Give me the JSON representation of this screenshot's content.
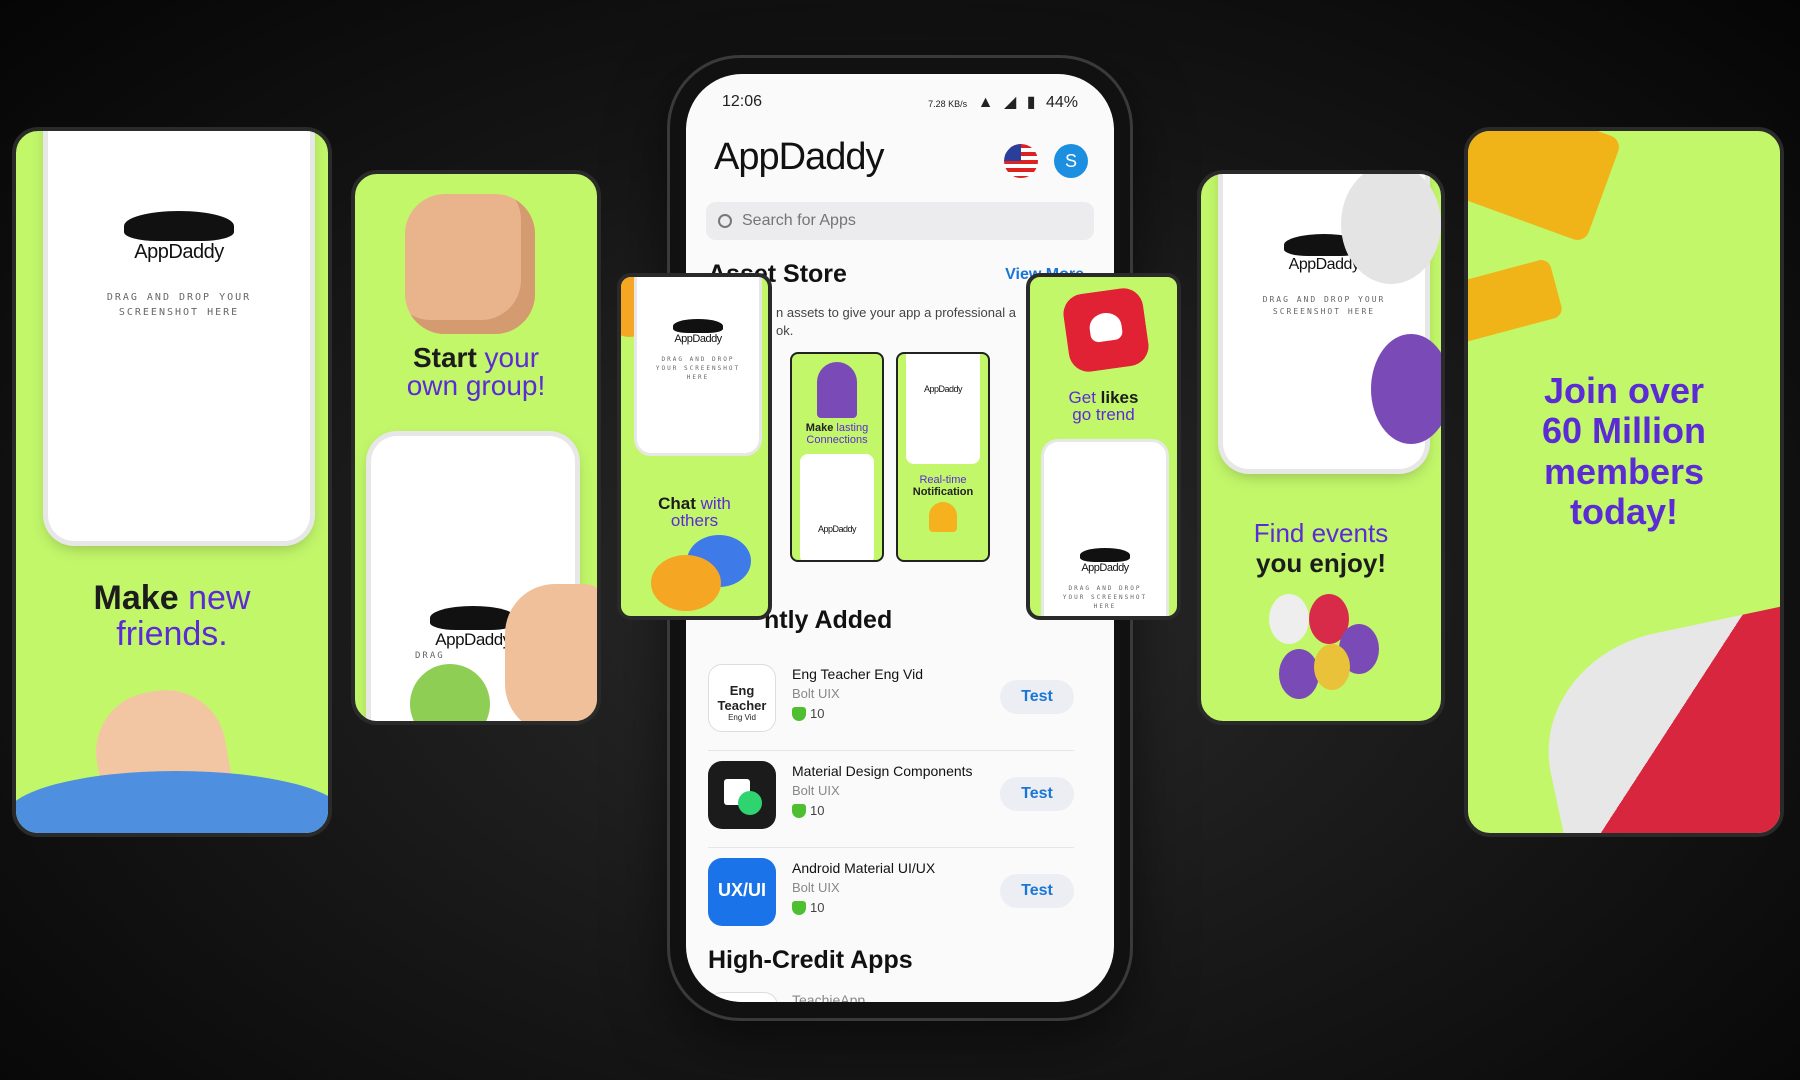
{
  "cards": {
    "c1": {
      "brand": "AppDaddy",
      "drop": "DRAG AND DROP YOUR SCREENSHOT HERE",
      "h_bold": "Make",
      "h_rest": "new",
      "h_line2": "friends."
    },
    "c2": {
      "h_bold": "Start",
      "h_rest": "your",
      "h_line2": "own group!",
      "brand": "AppDaddy",
      "drop": "DRAG"
    },
    "c3": {
      "brand": "AppDaddy",
      "drop": "DRAG AND DROP YOUR SCREENSHOT HERE",
      "h_bold": "Chat",
      "h_rest": "with",
      "h_line2": "others"
    },
    "c4": {
      "h_pre": "Get",
      "h_bold": "likes",
      "h_line2": "go trend",
      "brand": "AppDaddy",
      "drop": "DRAG AND DROP YOUR SCREENSHOT HERE"
    },
    "c5": {
      "brand": "AppDaddy",
      "drop": "DRAG AND DROP YOUR SCREENSHOT HERE",
      "h_line1": "Find events",
      "h_line2": "you enjoy!"
    },
    "c6": {
      "l1": "Join over",
      "l2": "60 Million",
      "l3": "members",
      "l4": "today!"
    }
  },
  "phone": {
    "status": {
      "time": "12:06",
      "speed": "7.28 KB/s",
      "battery": "44%"
    },
    "app_title": "AppDaddy",
    "avatar_letter": "S",
    "search_placeholder": "Search for Apps",
    "asset_store": {
      "title": "Asset Store",
      "view_more": "View More",
      "desc": "n assets to give your app a professional a",
      "desc2": "ok.",
      "mini1": {
        "pre": "Make",
        "rest": "lasting",
        "line2": "Connections",
        "brand": "AppDaddy"
      },
      "mini2": {
        "brand": "AppDaddy",
        "line1": "Real-time",
        "line2": "Notification"
      }
    },
    "recent": {
      "title": "ntly Added",
      "items": [
        {
          "name": "Eng Teacher Eng Vid",
          "dev": "Bolt UIX",
          "credits": "10",
          "button": "Test",
          "icon_text": "Eng Teacher",
          "icon_small": "Eng Vid"
        },
        {
          "name": "Material Design Components",
          "dev": "Bolt UIX",
          "credits": "10",
          "button": "Test"
        },
        {
          "name": "Android Material UI/UX",
          "dev": "Bolt UIX",
          "credits": "10",
          "button": "Test",
          "icon_text": "UX/UI"
        }
      ]
    },
    "high_credit": {
      "title": "High-Credit Apps",
      "first_item": "TeachieApp"
    }
  },
  "colors": {
    "card_green": "#c2f76a",
    "purple": "#5b2bd6",
    "link_blue": "#1877d6"
  }
}
